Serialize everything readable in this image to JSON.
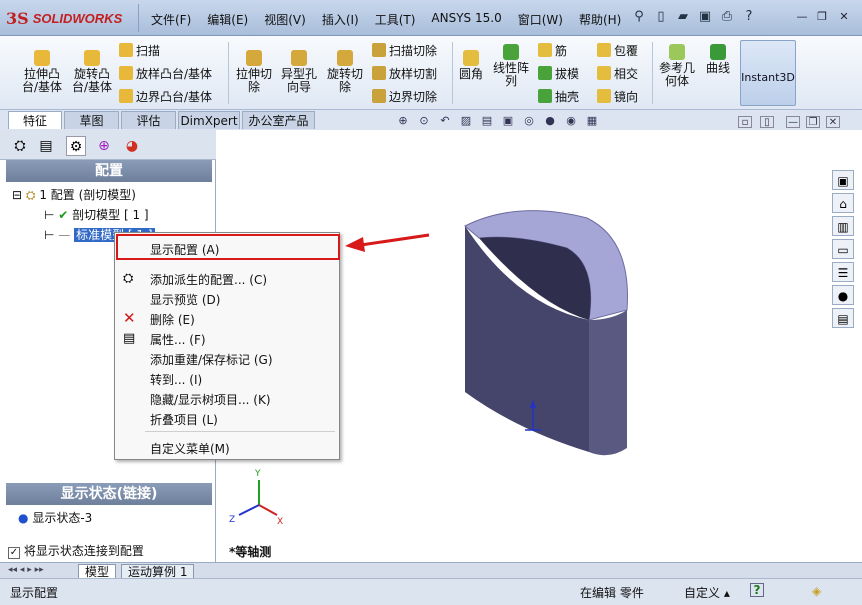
{
  "app": {
    "logo_mark": "3S",
    "logo_text": "SOLIDWORKS"
  },
  "menu": [
    "文件(F)",
    "编辑(E)",
    "视图(V)",
    "插入(I)",
    "工具(T)",
    "ANSYS 15.0",
    "窗口(W)",
    "帮助(H)"
  ],
  "ribbon": {
    "extrude_boss": "拉伸凸\n台/基体",
    "revolve_boss": "旋转凸\n台/基体",
    "sweep": "扫描",
    "loft_boss": "放样凸台/基体",
    "boundary_boss": "边界凸台/基体",
    "extrude_cut": "拉伸切\n除",
    "hole_wizard": "异型孔\n向导",
    "revolve_cut": "旋转切\n除",
    "swept_cut": "扫描切除",
    "lofted_cut": "放样切割",
    "boundary_cut": "边界切除",
    "fillet": "圆角",
    "linear_pattern": "线性阵\n列",
    "rib": "筋",
    "draft": "拔模",
    "shell": "抽壳",
    "wrap": "包覆",
    "intersect": "相交",
    "mirror": "镜向",
    "ref_geometry": "参考几\n何体",
    "curves": "曲线",
    "instant3d": "Instant3D"
  },
  "tabs": [
    "特征",
    "草图",
    "评估",
    "DimXpert",
    "办公室产品"
  ],
  "panel": {
    "config_header": "配置",
    "root": "1 配置  (剖切模型)",
    "config1": "剖切模型 [ 1 ]",
    "config2": "标准模型 [ 1 ]",
    "display_state_header": "显示状态(链接)",
    "display_state": "显示状态-3",
    "link_checkbox": "将显示状态连接到配置"
  },
  "context_menu": [
    "显示配置 (A)",
    "添加派生的配置... (C)",
    "显示预览 (D)",
    "删除 (E)",
    "属性... (F)",
    "添加重建/保存标记 (G)",
    "转到... (I)",
    "隐藏/显示树项目... (K)",
    "折叠项目 (L)",
    "自定义菜单(M)"
  ],
  "viewport": {
    "view_label": "*等轴测",
    "triad": {
      "x": "X",
      "y": "Y",
      "z": "Z"
    }
  },
  "bottom_tabs": [
    "模型",
    "运动算例 1"
  ],
  "status": {
    "left": "显示配置",
    "mode": "在编辑 零件",
    "custom": "自定义 ▴",
    "help": "?"
  },
  "colors": {
    "accent_red": "#d8191a",
    "selection_blue": "#3169c6",
    "part_purple": "#4b4a6e"
  }
}
